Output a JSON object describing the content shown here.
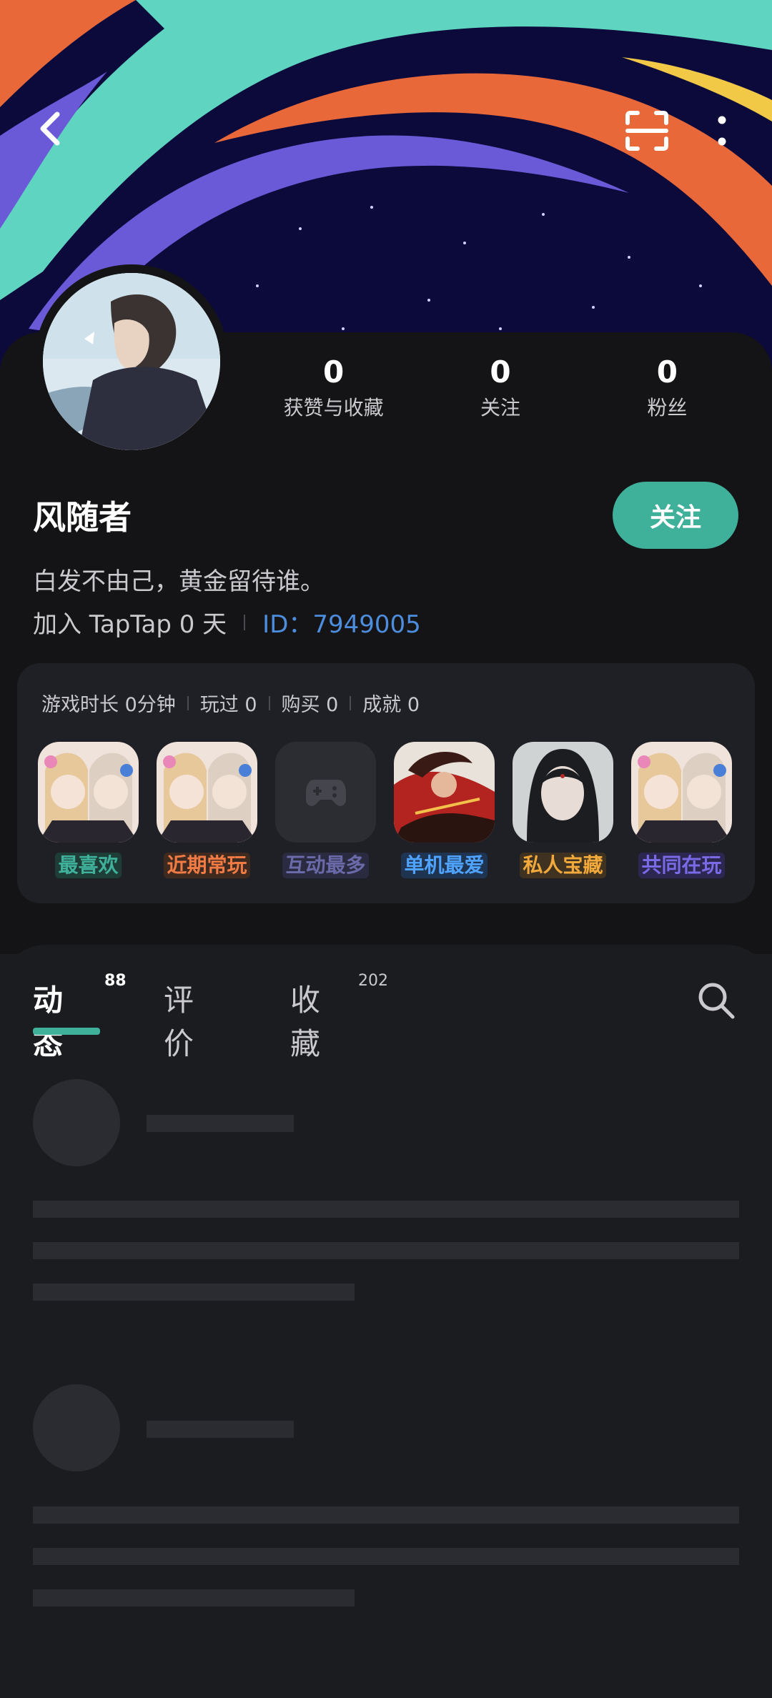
{
  "header": {
    "back_icon": "chevron-left-icon",
    "scan_icon": "scan-icon",
    "more_icon": "more-vertical-icon"
  },
  "profile": {
    "stats": [
      {
        "value": "0",
        "label": "获赞与收藏"
      },
      {
        "value": "0",
        "label": "关注"
      },
      {
        "value": "0",
        "label": "粉丝"
      }
    ],
    "username": "风随者",
    "follow_label": "关注",
    "bio": "白发不由己，黄金留待谁。",
    "joined": "加入 TapTap 0 天",
    "user_id": "ID：7949005"
  },
  "game_stats": {
    "items": [
      "游戏时长 0分钟",
      "玩过 0",
      "购买 0",
      "成就 0"
    ],
    "shelf": [
      {
        "label": "最喜欢",
        "color": "#3fb09a",
        "bg": "#1f3d37"
      },
      {
        "label": "近期常玩",
        "color": "#f07b45",
        "bg": "#3f2a20"
      },
      {
        "label": "互动最多",
        "color": "#6a6aa8",
        "bg": "#2a2a40"
      },
      {
        "label": "单机最爱",
        "color": "#4fa3ff",
        "bg": "#1e3450"
      },
      {
        "label": "私人宝藏",
        "color": "#f2a93b",
        "bg": "#3f3220"
      },
      {
        "label": "共同在玩",
        "color": "#7a6ae6",
        "bg": "#2b2750"
      }
    ]
  },
  "feed": {
    "tabs": [
      {
        "label": "动态",
        "count": "88"
      },
      {
        "label": "评价",
        "count": ""
      },
      {
        "label": "收藏",
        "count": "202"
      }
    ],
    "search_icon": "search-icon"
  },
  "colors": {
    "accent": "#3fb09a",
    "id_link": "#4d8dde",
    "background": "#1b1c20"
  }
}
